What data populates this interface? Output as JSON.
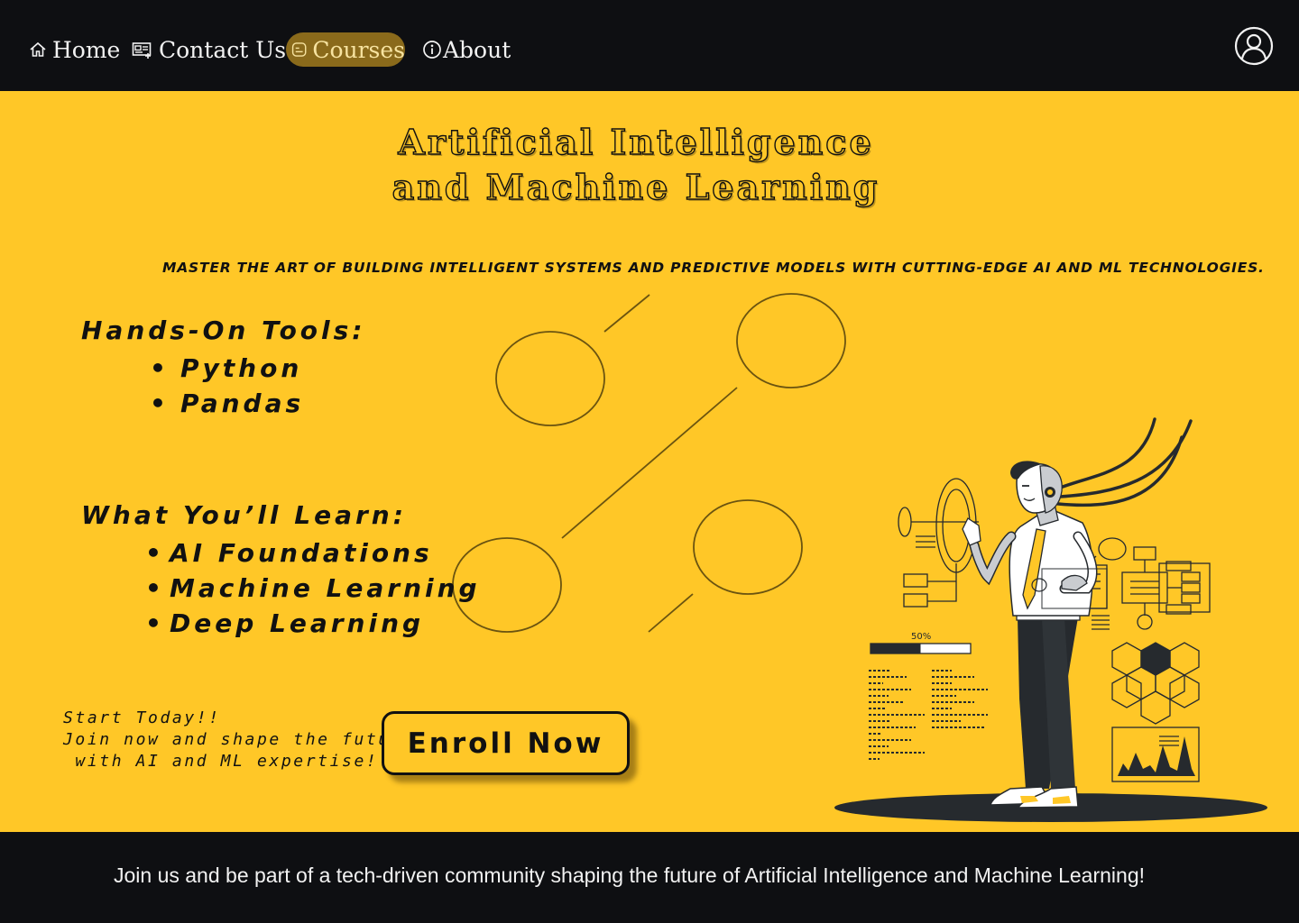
{
  "nav": {
    "items": [
      {
        "label": "Home",
        "icon": "home-icon"
      },
      {
        "label": "Contact Us",
        "icon": "contact-card-icon"
      },
      {
        "label": "Courses",
        "icon": "document-icon",
        "active": true
      },
      {
        "label": "About",
        "icon": "info-icon"
      }
    ],
    "profile_icon": "user-icon"
  },
  "hero": {
    "title_line1": "Artificial Intelligence",
    "title_line2": "and Machine Learning",
    "tagline": "MASTER THE ART OF BUILDING INTELLIGENT SYSTEMS AND PREDICTIVE MODELS WITH CUTTING-EDGE AI AND ML TECHNOLOGIES."
  },
  "tools": {
    "heading": "Hands-On Tools:",
    "items": [
      "Python",
      "Pandas"
    ]
  },
  "learn": {
    "heading": "What You’ll Learn:",
    "items": [
      "AI Foundations",
      "Machine Learning",
      "Deep Learning"
    ]
  },
  "cta": {
    "line1": "Start Today!!",
    "line2": "Join now and shape the future",
    "line3": " with AI and ML expertise!",
    "button": "Enroll Now"
  },
  "illustration": {
    "progress_label": "50%",
    "progress": 0.5
  },
  "footer": {
    "text": "Join us and be part of a tech-driven community shaping the future of Artificial Intelligence and Machine Learning!"
  },
  "colors": {
    "background": "#ffc727",
    "nav_bg": "#0e0f12",
    "active_tab": "#8a6a1b",
    "text_dark": "#111111"
  }
}
